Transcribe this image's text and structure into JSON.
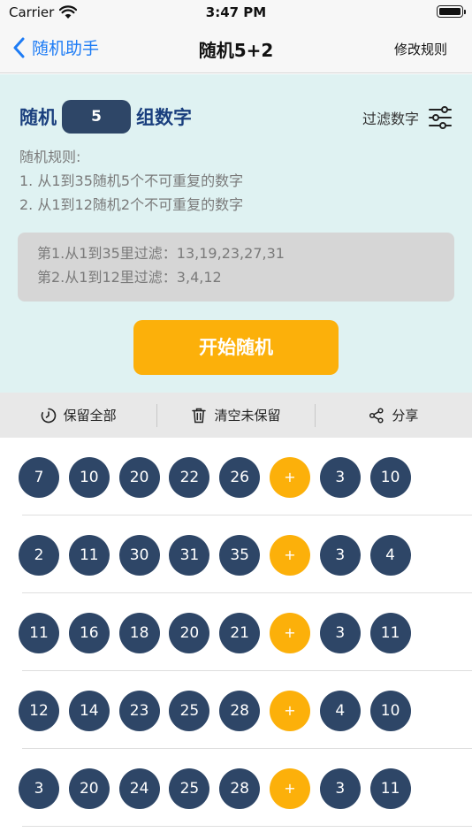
{
  "status_bar": {
    "carrier": "Carrier",
    "time": "3:47 PM"
  },
  "nav": {
    "back_label": "随机助手",
    "title": "随机5+2",
    "right_label": "修改规则"
  },
  "config": {
    "group_prefix": "随机",
    "group_count": "5",
    "group_suffix": "组数字",
    "filter_label": "过滤数字",
    "rules_title": "随机规则:",
    "rules": [
      "1. 从1到35随机5个不可重复的数字",
      "2. 从1到12随机2个不可重复的数字"
    ],
    "filters": [
      "第1.从1到35里过滤：13,19,23,27,31",
      "第2.从1到12里过滤：3,4,12"
    ],
    "start_label": "开始随机"
  },
  "toolbar": {
    "keep_all": "保留全部",
    "clear_unkept": "清空未保留",
    "share": "分享"
  },
  "plus_symbol": "+",
  "results": [
    {
      "front": [
        "7",
        "10",
        "20",
        "22",
        "26"
      ],
      "back": [
        "3",
        "10"
      ]
    },
    {
      "front": [
        "2",
        "11",
        "30",
        "31",
        "35"
      ],
      "back": [
        "3",
        "4"
      ]
    },
    {
      "front": [
        "11",
        "16",
        "18",
        "20",
        "21"
      ],
      "back": [
        "3",
        "11"
      ]
    },
    {
      "front": [
        "12",
        "14",
        "23",
        "25",
        "28"
      ],
      "back": [
        "4",
        "10"
      ]
    },
    {
      "front": [
        "3",
        "20",
        "24",
        "25",
        "28"
      ],
      "back": [
        "3",
        "11"
      ]
    }
  ],
  "colors": {
    "accent_blue": "#1e7cf5",
    "ball_navy": "#2e4667",
    "ball_orange": "#fcb00a",
    "panel_bg": "#dff2f2"
  }
}
